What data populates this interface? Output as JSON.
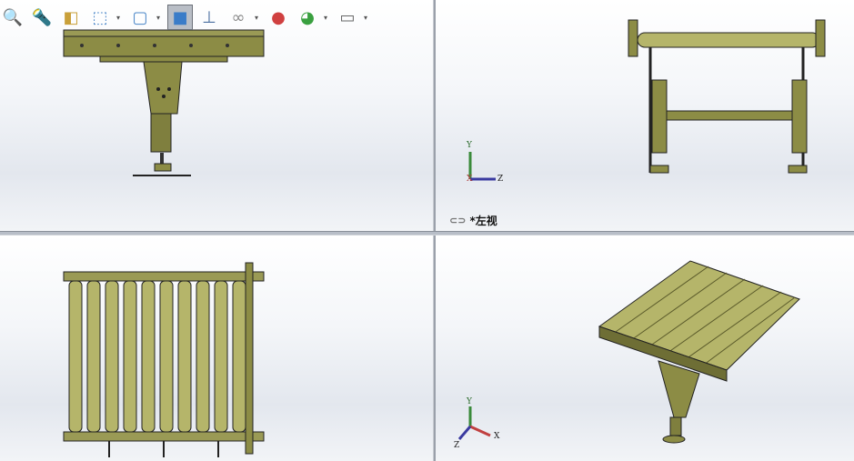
{
  "toolbar": {
    "items": [
      {
        "icon": "zoom-to-area-icon",
        "glyph": "🔍"
      },
      {
        "icon": "previous-view-icon",
        "glyph": "🔦"
      },
      {
        "icon": "section-view-icon",
        "glyph": "◧"
      },
      {
        "icon": "view-orientation-icon",
        "glyph": "⬚",
        "dropdown": true
      },
      {
        "icon": "display-style-icon",
        "glyph": "▢",
        "dropdown": true
      },
      {
        "icon": "shaded-view-icon",
        "glyph": "■",
        "selected": true
      },
      {
        "icon": "hide-show-items-icon",
        "glyph": "⊥"
      },
      {
        "icon": "edit-appearance-icon",
        "glyph": "∞",
        "dropdown": true
      },
      {
        "icon": "apply-scene-icon",
        "glyph": "●"
      },
      {
        "icon": "view-settings-icon",
        "glyph": "◕",
        "dropdown": true
      },
      {
        "icon": "display-monitor-icon",
        "glyph": "▭",
        "dropdown": true
      }
    ]
  },
  "viewports": {
    "left_view": {
      "label": "*左视",
      "link_icon": "link-icon"
    },
    "axes": {
      "x": "X",
      "y": "Y",
      "z": "Z"
    }
  },
  "colors": {
    "model": "#8c8c45",
    "roller": "#b5b56a",
    "dark": "#2a2a14"
  }
}
